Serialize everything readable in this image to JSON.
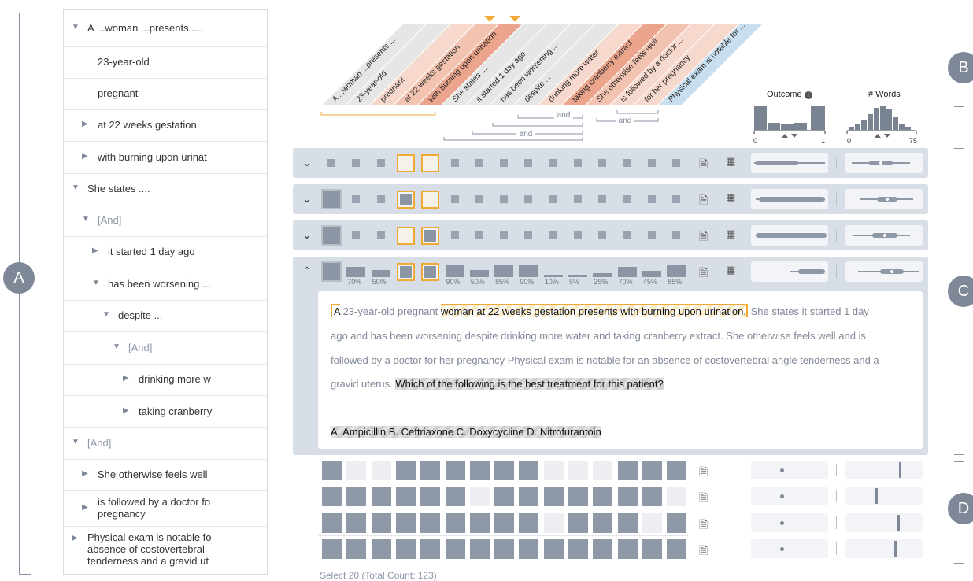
{
  "sections": {
    "a": "A",
    "b": "B",
    "c": "C",
    "d": "D"
  },
  "tree": [
    {
      "label": "A ...woman ...presents ....",
      "toggle": "▼",
      "indent": 0
    },
    {
      "label": "23-year-old",
      "toggle": "",
      "indent": 1
    },
    {
      "label": "pregnant",
      "toggle": "",
      "indent": 1
    },
    {
      "label": "at 22 weeks gestation",
      "toggle": "▶",
      "indent": 1
    },
    {
      "label": "with burning upon urinat",
      "toggle": "▶",
      "indent": 1
    },
    {
      "label": "She states ....",
      "toggle": "▼",
      "indent": 0
    },
    {
      "label": "[And]",
      "toggle": "▼",
      "indent": 1
    },
    {
      "label": "it started 1 day ago",
      "toggle": "▶",
      "indent": 2
    },
    {
      "label": "has been worsening ...",
      "toggle": "▼",
      "indent": 2
    },
    {
      "label": "despite ...",
      "toggle": "▼",
      "indent": 3
    },
    {
      "label": "[And]",
      "toggle": "▼",
      "indent": 4
    },
    {
      "label": "drinking more w",
      "toggle": "▶",
      "indent": 5
    },
    {
      "label": "taking cranberry",
      "toggle": "▶",
      "indent": 5
    },
    {
      "label": "[And]",
      "toggle": "▼",
      "indent": 0
    },
    {
      "label": "She otherwise feels well",
      "toggle": "▶",
      "indent": 1
    },
    {
      "label": "is followed by a doctor fo pregnancy",
      "toggle": "▶",
      "indent": 1
    },
    {
      "label": "Physical exam is notable fo absence of costovertebral tenderness and a gravid ut",
      "toggle": "▶",
      "indent": 0
    }
  ],
  "header": {
    "columns": [
      "A ...woman ...presents ....",
      "23-year-old",
      "pregnant",
      "at 22 weeks gestation",
      "with burning upon urination",
      "She states ....",
      "it started 1 day ago",
      "has been worsening ...",
      "despite ...",
      "drinking more water",
      "taking cranberry extract",
      "She otherwise feels well",
      "is followed by a doctor ...",
      "for her pregnancy",
      "Physical exam is notable for ..."
    ],
    "column_colors": [
      "#e6e6e6",
      "#e6e6e6",
      "#f7d8cc",
      "#f2c3b0",
      "#eba58d",
      "#e6e6e6",
      "#e6e6e6",
      "#e6e6e6",
      "#e6e6e6",
      "#f7d8cc",
      "#eba58d",
      "#f2c3b0",
      "#f7d8cc",
      "#f7d8cc",
      "#c9dff0"
    ],
    "and_label": "and",
    "outcome_label": "Outcome",
    "outcome_min": "0",
    "outcome_max": "1",
    "words_label": "# Words",
    "words_min": "0",
    "words_max": "75"
  },
  "expanded_row": {
    "percents": [
      "70%",
      "50%",
      "",
      "",
      "90%",
      "50%",
      "85%",
      "90%",
      "10%",
      "5%",
      "25%",
      "70%",
      "45%",
      "85%"
    ],
    "text": {
      "l1_a": "A",
      "l1_b": " 23-year-old pregnant ",
      "l1_c": "woman at 22 weeks gestation presents with burning upon urination.",
      "l1_d": " She states it started 1 day",
      "l2": "ago and has been worsening despite drinking more water and taking cranberry extract. She otherwise feels well and is",
      "l3": "followed by a doctor for her pregnancy Physical exam is notable for an absence of costovertebral angle tenderness and a",
      "l4_a": "gravid uterus. ",
      "l4_b": "Which of the following is the best treatment for this patient?",
      "l5": "A. Ampicillin B. Ceftriaxone C. Doxycycline D. Nitrofurantoin"
    }
  },
  "footer": "Select 20 (Total Count: 123)",
  "colors": {
    "accent": "#f0a935",
    "row_bg": "#d8dee6",
    "cell": "#8f98a6",
    "badge": "#7f8897"
  },
  "icons": {
    "doc": "document-icon",
    "chart": "bar-chart-icon",
    "chevron": "chevron-icon"
  }
}
